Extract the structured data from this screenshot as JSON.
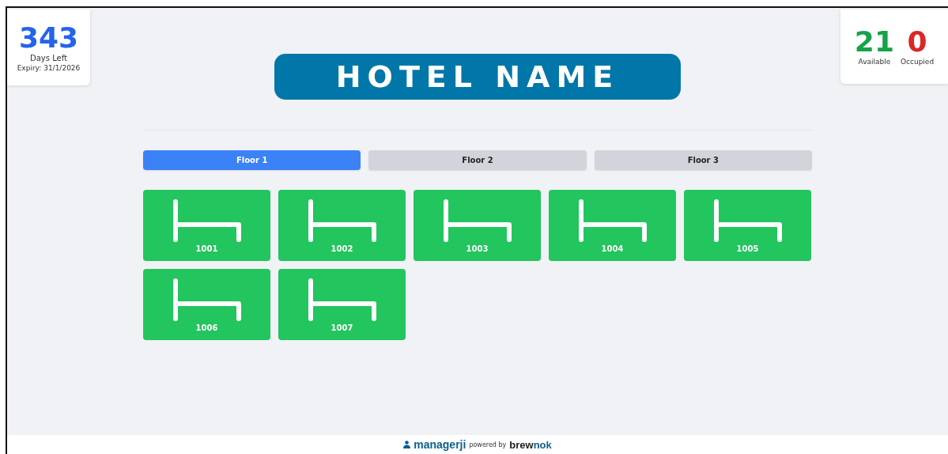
{
  "license": {
    "days": "343",
    "days_label": "Days Left",
    "expiry": "Expiry: 31/1/2026"
  },
  "stats": [
    {
      "value": "21",
      "label": "Available",
      "color": "#16a34a"
    },
    {
      "value": "0",
      "label": "Occupied",
      "color": "#dc2626"
    }
  ],
  "hotel_name": "HOTEL NAME",
  "tabs": [
    {
      "label": "Floor 1",
      "selected": true
    },
    {
      "label": "Floor 2",
      "selected": false
    },
    {
      "label": "Floor 3",
      "selected": false
    }
  ],
  "rooms": [
    {
      "number": "1001",
      "color": "#22c55e"
    },
    {
      "number": "1002",
      "color": "#22c55e"
    },
    {
      "number": "1003",
      "color": "#22c55e"
    },
    {
      "number": "1004",
      "color": "#22c55e"
    },
    {
      "number": "1005",
      "color": "#22c55e"
    },
    {
      "number": "1006",
      "color": "#22c55e"
    },
    {
      "number": "1007",
      "color": "#22c55e"
    }
  ],
  "footer": {
    "app": "managerji",
    "powered": "powered by",
    "vendor_main": "brew",
    "vendor_accent": "nok"
  }
}
